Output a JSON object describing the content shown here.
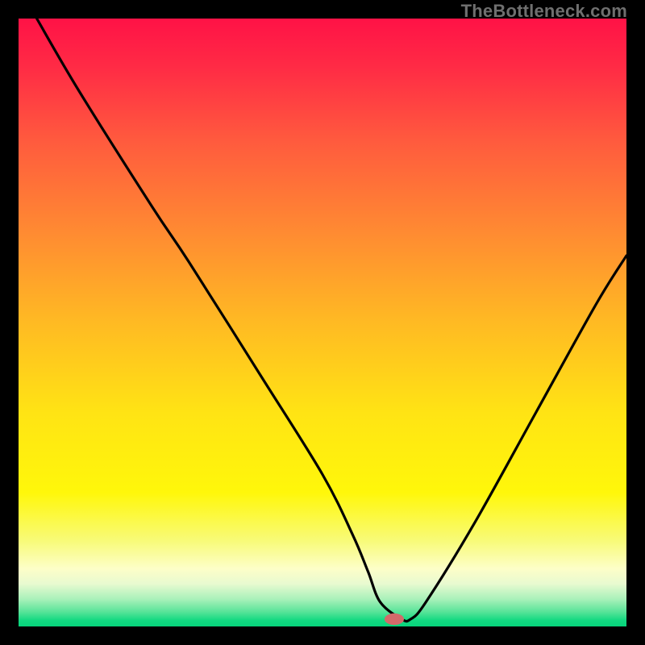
{
  "watermark": "TheBottleneck.com",
  "chart_data": {
    "type": "line",
    "title": "",
    "xlabel": "",
    "ylabel": "",
    "xlim": [
      0,
      100
    ],
    "ylim": [
      0,
      100
    ],
    "gradient_stops": [
      {
        "offset": 0.0,
        "color": "#ff1246"
      },
      {
        "offset": 0.08,
        "color": "#ff2b45"
      },
      {
        "offset": 0.2,
        "color": "#ff5a3e"
      },
      {
        "offset": 0.35,
        "color": "#ff8a32"
      },
      {
        "offset": 0.5,
        "color": "#ffba23"
      },
      {
        "offset": 0.65,
        "color": "#ffe414"
      },
      {
        "offset": 0.78,
        "color": "#fff70a"
      },
      {
        "offset": 0.86,
        "color": "#f8fb7a"
      },
      {
        "offset": 0.905,
        "color": "#fdfec8"
      },
      {
        "offset": 0.93,
        "color": "#e8fad0"
      },
      {
        "offset": 0.955,
        "color": "#a9f1ba"
      },
      {
        "offset": 0.975,
        "color": "#5ce49a"
      },
      {
        "offset": 0.99,
        "color": "#12d981"
      },
      {
        "offset": 1.0,
        "color": "#06d47b"
      }
    ],
    "series": [
      {
        "name": "bottleneck-curve",
        "x": [
          3.0,
          10.0,
          22.0,
          28.0,
          40.0,
          50.0,
          55.0,
          57.5,
          59.5,
          63.0,
          64.5,
          67.0,
          75.0,
          85.0,
          95.0,
          100.0
        ],
        "y": [
          100.0,
          88.0,
          69.0,
          60.0,
          41.0,
          25.0,
          15.0,
          9.0,
          4.0,
          1.2,
          1.2,
          4.0,
          17.0,
          35.0,
          53.0,
          61.0
        ]
      }
    ],
    "marker": {
      "name": "optimal-marker",
      "x": 61.8,
      "y": 1.2,
      "rx": 1.6,
      "ry": 0.95,
      "fill": "#d36a6a"
    }
  }
}
